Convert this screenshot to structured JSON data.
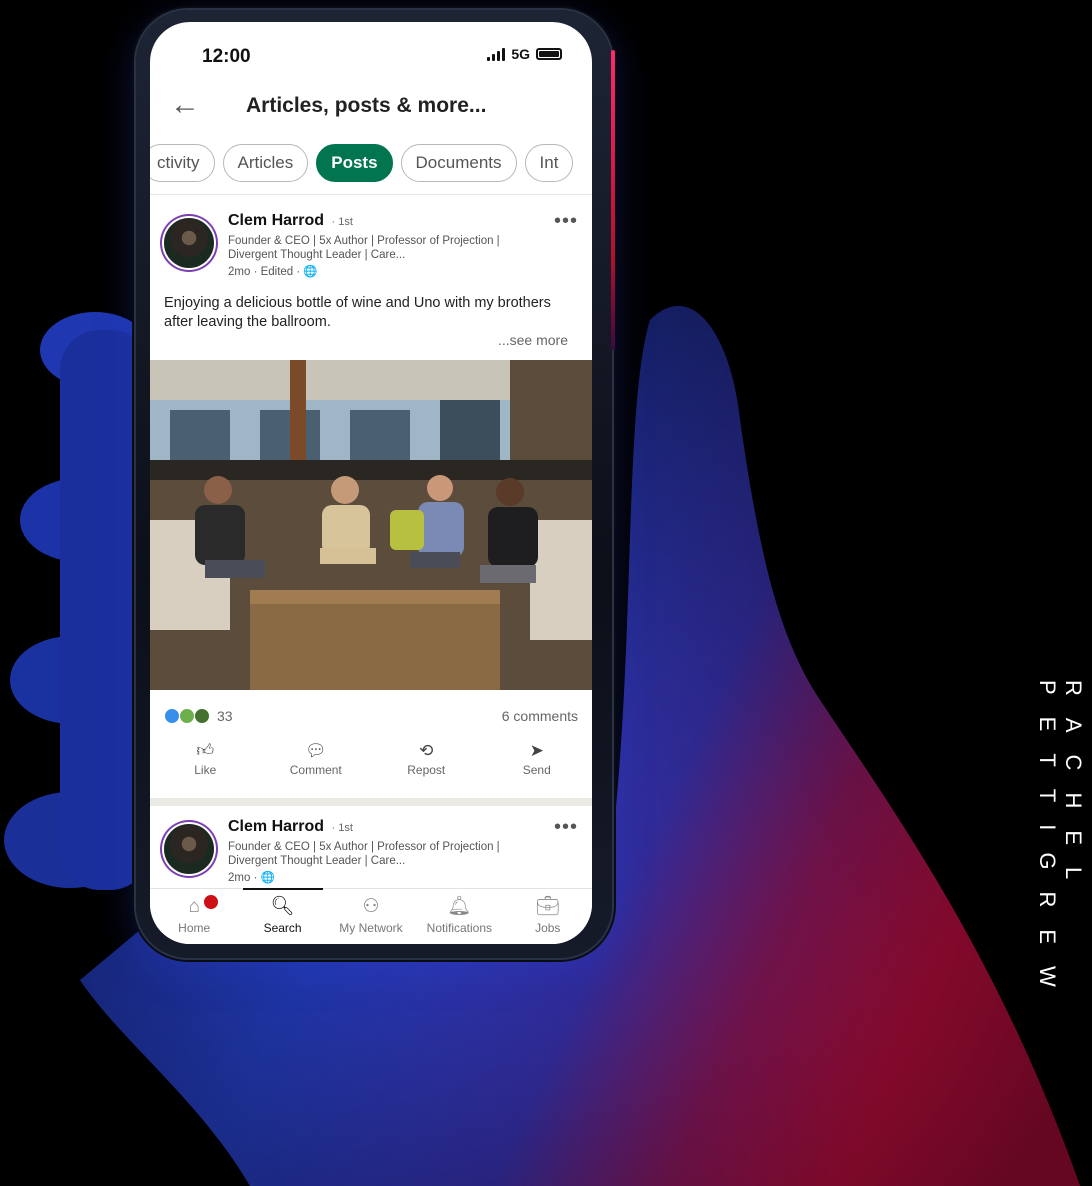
{
  "status_bar": {
    "time": "12:00",
    "network": "5G"
  },
  "header": {
    "title": "Articles, posts & more..."
  },
  "filters": {
    "chips": [
      {
        "label": "ctivity",
        "active": false
      },
      {
        "label": "Articles",
        "active": false
      },
      {
        "label": "Posts",
        "active": true
      },
      {
        "label": "Documents",
        "active": false
      },
      {
        "label": "Int",
        "active": false
      }
    ]
  },
  "posts": [
    {
      "author": "Clem Harrod",
      "degree": "· 1st",
      "headline": "Founder & CEO | 5x Author | Professor of Projection | Divergent Thought Leader | Care...",
      "meta": "2mo · Edited · ",
      "text": "Enjoying a delicious bottle of wine and Uno with my brothers after leaving the ballroom.",
      "see_more": "...see more",
      "reaction_count": "33",
      "comments": "6 comments",
      "actions": [
        "Like",
        "Comment",
        "Repost",
        "Send"
      ]
    },
    {
      "author": "Clem Harrod",
      "degree": "· 1st",
      "headline": "Founder & CEO | 5x Author | Professor of Projection | Divergent Thought Leader | Care...",
      "meta": "2mo · "
    }
  ],
  "bottom_nav": {
    "items": [
      {
        "label": "Home",
        "icon": "home-icon",
        "active": false
      },
      {
        "label": "Search",
        "icon": "search-icon",
        "active": true
      },
      {
        "label": "My Network",
        "icon": "network-icon",
        "active": false
      },
      {
        "label": "Notifications",
        "icon": "bell-icon",
        "active": false
      },
      {
        "label": "Jobs",
        "icon": "briefcase-icon",
        "active": false
      }
    ]
  },
  "side_text": "RACHEL PETTIGREW",
  "colors": {
    "accent": "#01754f",
    "badge": "#cc1016"
  }
}
